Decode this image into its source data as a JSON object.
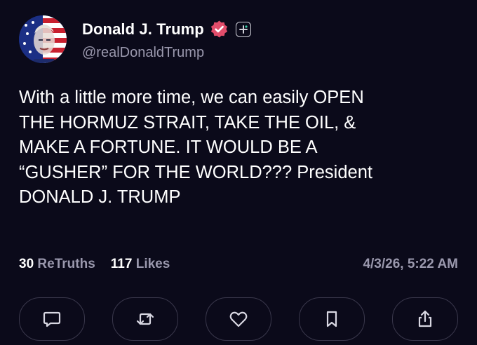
{
  "profile": {
    "display_name": "Donald J. Trump",
    "handle": "@realDonaldTrump",
    "avatar_icon": "flag-portrait-avatar",
    "verified_icon": "verified-badge-icon",
    "follow_icon": "plus-icon"
  },
  "post": {
    "text": "With a little more time, we can easily OPEN\nTHE HORMUZ STRAIT, TAKE THE OIL, &\nMAKE A FORTUNE. IT WOULD BE A\n“GUSHER” FOR THE WORLD??? President\nDONALD J. TRUMP"
  },
  "stats": {
    "retruths_count": "30",
    "retruths_label": "ReTruths",
    "likes_count": "117",
    "likes_label": "Likes",
    "timestamp": "4/3/26, 5:22 AM"
  },
  "actions": [
    {
      "name": "reply",
      "icon": "comment-icon"
    },
    {
      "name": "retruth",
      "icon": "repost-icon"
    },
    {
      "name": "like",
      "icon": "heart-icon"
    },
    {
      "name": "bookmark",
      "icon": "bookmark-icon"
    },
    {
      "name": "share",
      "icon": "share-icon"
    }
  ],
  "colors": {
    "background": "#0b0a1a",
    "muted_text": "#9a98ad",
    "verified_badge": "#e24d6b",
    "button_border": "#3a384c"
  }
}
